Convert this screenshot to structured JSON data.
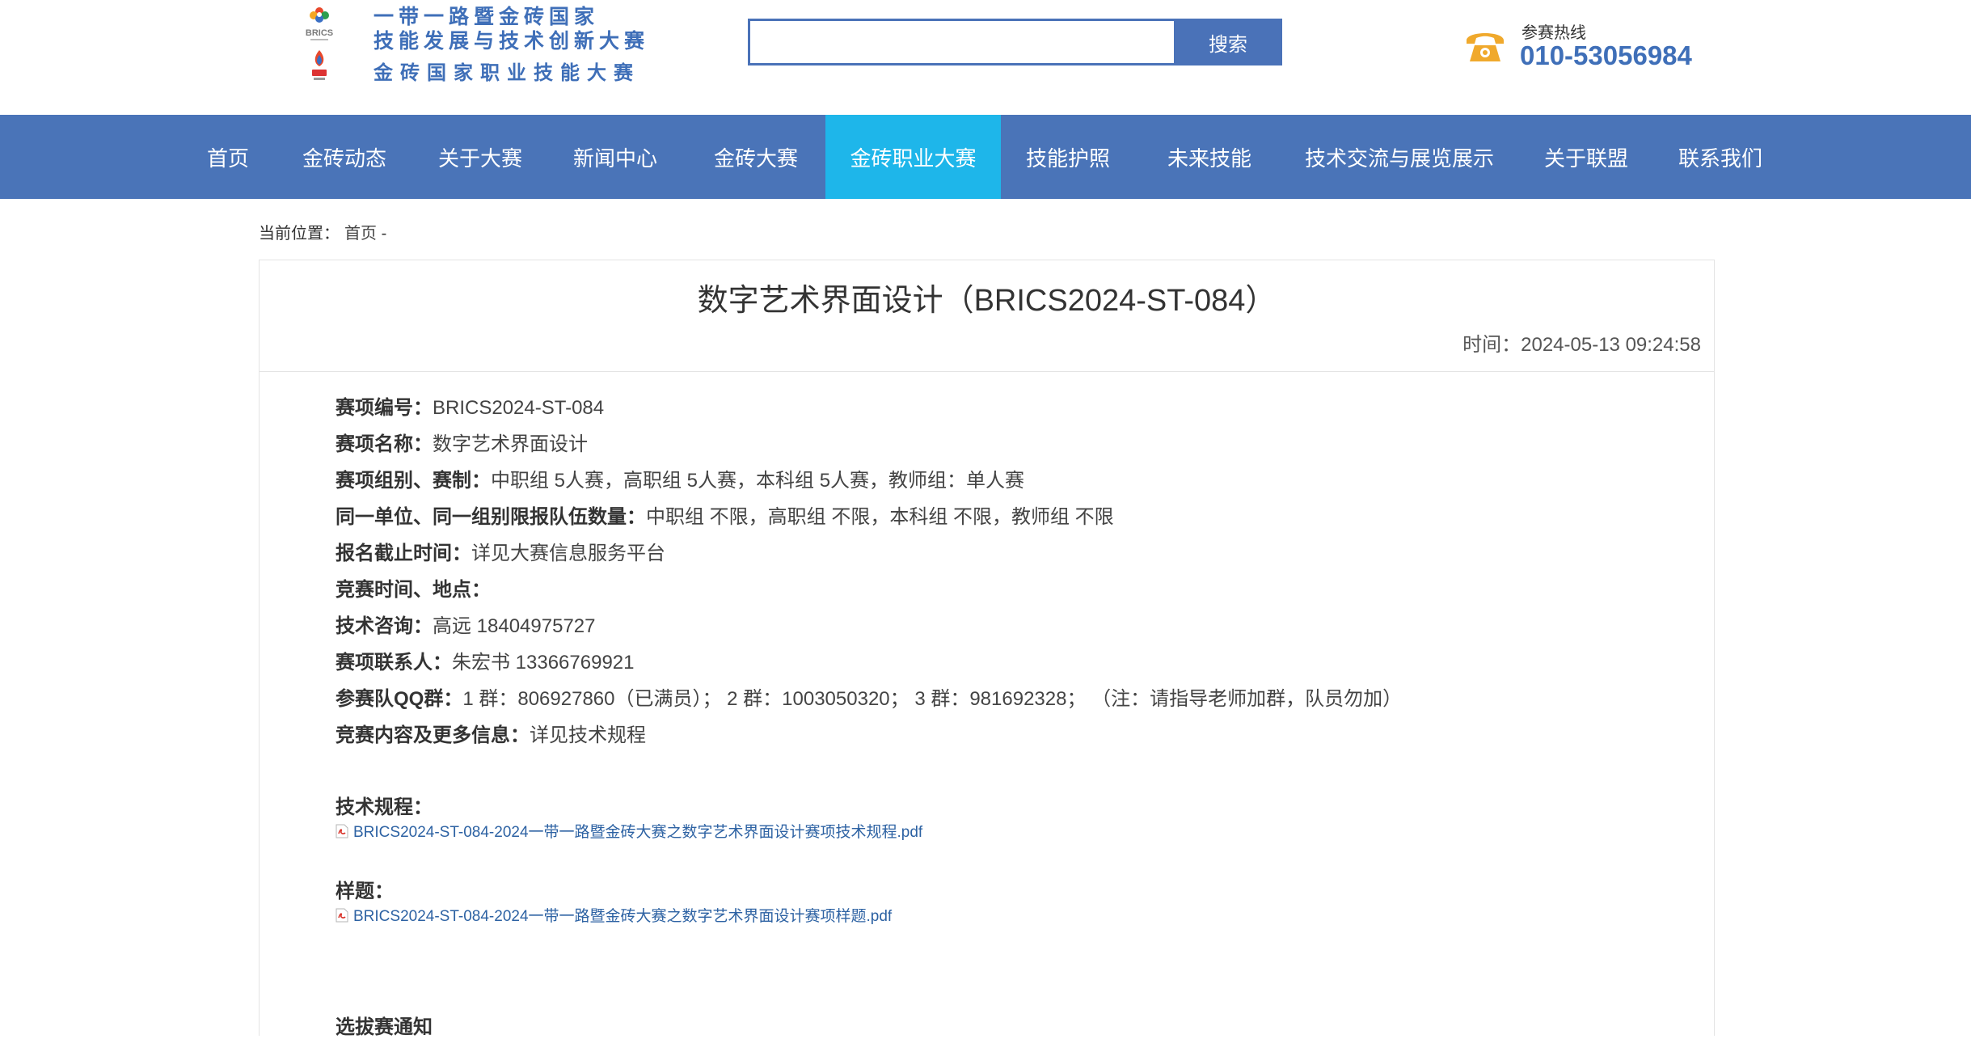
{
  "header": {
    "logo_lines": [
      "一带一路暨金砖国家",
      "技能发展与技术创新大赛",
      "金砖国家职业技能大赛"
    ],
    "logo_badge_text": "BRICS",
    "search": {
      "value": "",
      "placeholder": "",
      "button_label": "搜索"
    },
    "hotline": {
      "label": "参赛热线",
      "number": "010-53056984"
    }
  },
  "nav": {
    "items": [
      {
        "label": "首页"
      },
      {
        "label": "金砖动态"
      },
      {
        "label": "关于大赛"
      },
      {
        "label": "新闻中心"
      },
      {
        "label": "金砖大赛"
      },
      {
        "label": "金砖职业大赛"
      },
      {
        "label": "技能护照"
      },
      {
        "label": "未来技能"
      },
      {
        "label": "技术交流与展览展示"
      },
      {
        "label": "关于联盟"
      },
      {
        "label": "联系我们"
      }
    ],
    "active_index": 5,
    "colors": {
      "bar": "#4a74b8",
      "active": "#1eb6ea"
    }
  },
  "breadcrumb": {
    "prefix": "当前位置：",
    "home": "首页",
    "separator": "-"
  },
  "article": {
    "title": "数字艺术界面设计（BRICS2024-ST-084）",
    "time": "时间：2024-05-13 09:24:58",
    "info": [
      {
        "label": "赛项编号：",
        "value": "BRICS2024-ST-084"
      },
      {
        "label": "赛项名称：",
        "value": "数字艺术界面设计"
      },
      {
        "label": "赛项组别、赛制：",
        "value": "中职组 5人赛，高职组 5人赛，本科组 5人赛，教师组：单人赛"
      },
      {
        "label": "同一单位、同一组别限报队伍数量：",
        "value": "中职组 不限，高职组 不限，本科组 不限，教师组 不限"
      },
      {
        "label": "报名截止时间：",
        "value": "详见大赛信息服务平台"
      },
      {
        "label": "竞赛时间、地点：",
        "value": ""
      },
      {
        "label": "技术咨询：",
        "value": "高远 18404975727"
      },
      {
        "label": "赛项联系人：",
        "value": "朱宏书 13366769921"
      },
      {
        "label": "参赛队QQ群：",
        "value": "1 群：806927860（已满员）； 2 群：1003050320； 3 群：981692328；  （注：请指导老师加群，队员勿加）"
      },
      {
        "label": "竞赛内容及更多信息：",
        "value": "详见技术规程"
      }
    ],
    "tech_rules": {
      "title": "技术规程：",
      "file": "BRICS2024-ST-084-2024一带一路暨金砖大赛之数字艺术界面设计赛项技术规程.pdf"
    },
    "sample": {
      "title": "样题：",
      "file": "BRICS2024-ST-084-2024一带一路暨金砖大赛之数字艺术界面设计赛项样题.pdf"
    },
    "next_section_partial": "选拔赛通知"
  }
}
